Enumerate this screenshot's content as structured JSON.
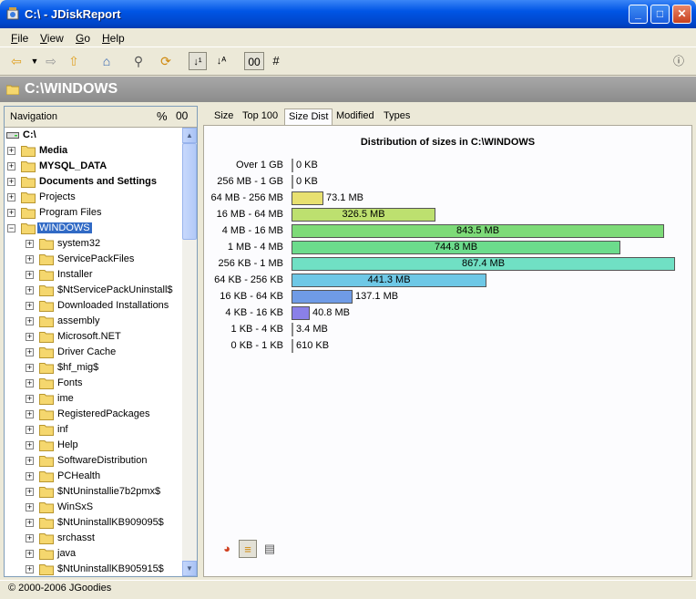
{
  "window": {
    "title": "C:\\ - JDiskReport"
  },
  "menu": [
    {
      "label": "File",
      "key": "F",
      "rest": "ile"
    },
    {
      "label": "View",
      "key": "V",
      "rest": "iew"
    },
    {
      "label": "Go",
      "key": "G",
      "rest": "o"
    },
    {
      "label": "Help",
      "key": "H",
      "rest": "elp"
    }
  ],
  "toolbar": {
    "oo_label": "00",
    "hash_label": "#"
  },
  "header": {
    "path": "C:\\WINDOWS"
  },
  "navigation": {
    "title": "Navigation",
    "percent_label": "%",
    "oo_label": "00",
    "root": "C:\\",
    "items": [
      {
        "label": "Media",
        "bold": true,
        "level": 1
      },
      {
        "label": "MYSQL_DATA",
        "bold": true,
        "level": 1
      },
      {
        "label": "Documents and Settings",
        "bold": true,
        "level": 1
      },
      {
        "label": "Projects",
        "bold": false,
        "level": 1
      },
      {
        "label": "Program Files",
        "bold": false,
        "level": 1
      },
      {
        "label": "WINDOWS",
        "bold": false,
        "level": 1,
        "selected": true,
        "expanded": true
      },
      {
        "label": "system32",
        "level": 2
      },
      {
        "label": "ServicePackFiles",
        "level": 2
      },
      {
        "label": "Installer",
        "level": 2
      },
      {
        "label": "$NtServicePackUninstall$",
        "level": 2
      },
      {
        "label": "Downloaded Installations",
        "level": 2
      },
      {
        "label": "assembly",
        "level": 2
      },
      {
        "label": "Microsoft.NET",
        "level": 2
      },
      {
        "label": "Driver Cache",
        "level": 2
      },
      {
        "label": "$hf_mig$",
        "level": 2
      },
      {
        "label": "Fonts",
        "level": 2
      },
      {
        "label": "ime",
        "level": 2
      },
      {
        "label": "RegisteredPackages",
        "level": 2
      },
      {
        "label": "inf",
        "level": 2
      },
      {
        "label": "Help",
        "level": 2
      },
      {
        "label": "SoftwareDistribution",
        "level": 2
      },
      {
        "label": "PCHealth",
        "level": 2
      },
      {
        "label": "$NtUninstallie7b2pmx$",
        "level": 2
      },
      {
        "label": "WinSxS",
        "level": 2
      },
      {
        "label": "$NtUninstallKB909095$",
        "level": 2
      },
      {
        "label": "srchasst",
        "level": 2
      },
      {
        "label": "java",
        "level": 2
      },
      {
        "label": "$NtUninstallKB905915$",
        "level": 2
      }
    ]
  },
  "tabs": [
    {
      "label": "Size"
    },
    {
      "label": "Top 100"
    },
    {
      "label": "Size Dist",
      "active": true
    },
    {
      "label": "Modified"
    },
    {
      "label": "Types"
    }
  ],
  "chart_data": {
    "type": "bar",
    "orientation": "horizontal",
    "title": "Distribution of sizes in C:\\WINDOWS",
    "unit": "MB",
    "categories": [
      "Over 1 GB",
      "256 MB - 1 GB",
      "64 MB - 256 MB",
      "16 MB - 64 MB",
      "4 MB - 16 MB",
      "1 MB - 4 MB",
      "256 KB - 1 MB",
      "64 KB - 256 KB",
      "16 KB - 64 KB",
      "4 KB - 16 KB",
      "1 KB - 4 KB",
      "0 KB - 1 KB"
    ],
    "values": [
      0,
      0,
      73.1,
      326.5,
      843.5,
      744.8,
      867.4,
      441.3,
      137.1,
      40.8,
      3.4,
      0.6
    ],
    "labels": [
      "0 KB",
      "0 KB",
      "73.1 MB",
      "326.5 MB",
      "843.5 MB",
      "744.8 MB",
      "867.4 MB",
      "441.3 MB",
      "137.1 MB",
      "40.8 MB",
      "3.4 MB",
      "610 KB"
    ],
    "colors": [
      "#888888",
      "#888888",
      "#e8e070",
      "#bde06f",
      "#7ddb78",
      "#6cdc8c",
      "#70e0c4",
      "#6ec8e6",
      "#6f9be6",
      "#8a80e8",
      "#888888",
      "#888888"
    ],
    "xlim": [
      0,
      867.4
    ]
  },
  "status": {
    "text": "© 2000-2006 JGoodies"
  }
}
